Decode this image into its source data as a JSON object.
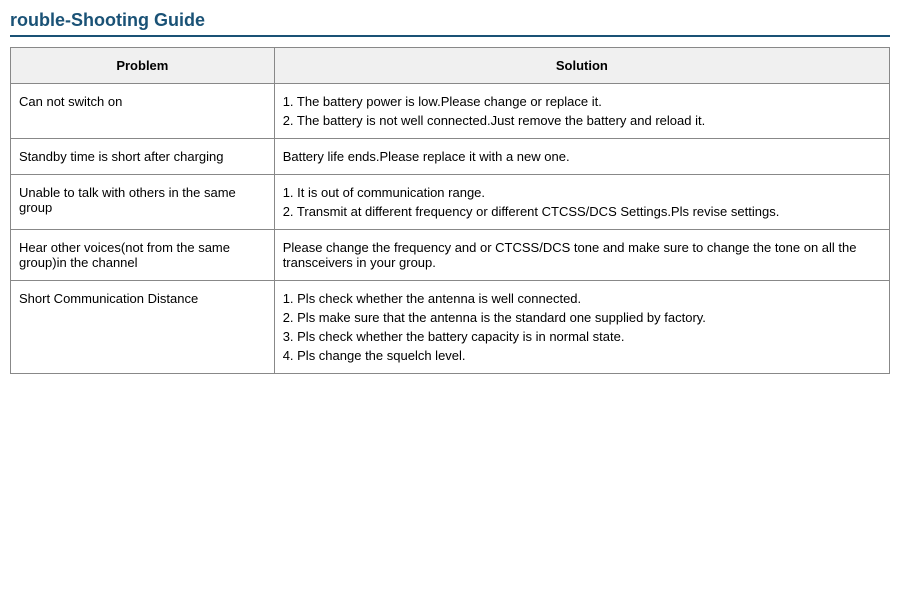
{
  "page": {
    "title": "rouble-Shooting Guide"
  },
  "table": {
    "headers": {
      "problem": "Problem",
      "solution": "Solution"
    },
    "rows": [
      {
        "problem": "Can not switch on",
        "solutions": [
          "1. The battery power is low.Please change or replace it.",
          "2. The battery is not well connected.Just remove the battery and reload it."
        ]
      },
      {
        "problem": "Standby time is short after charging",
        "solutions": [
          "Battery life ends.Please replace it with a new one."
        ]
      },
      {
        "problem": "Unable to talk with others in the same group",
        "solutions": [
          "1. It is out of communication range.",
          "2.  Transmit at different frequency or different CTCSS/DCS Settings.Pls revise settings."
        ]
      },
      {
        "problem": "Hear other voices(not from the same group)in the channel",
        "solutions": [
          "Please change the frequency and or CTCSS/DCS tone and make sure to change the tone on all the transceivers in your group."
        ]
      },
      {
        "problem": "Short Communication Distance",
        "solutions": [
          "1. Pls check whether the antenna is well connected.",
          "2. Pls make sure that the antenna is the standard one supplied by factory.",
          "3. Pls check whether the battery capacity is in normal state.",
          "4. Pls change the squelch level."
        ]
      }
    ]
  }
}
